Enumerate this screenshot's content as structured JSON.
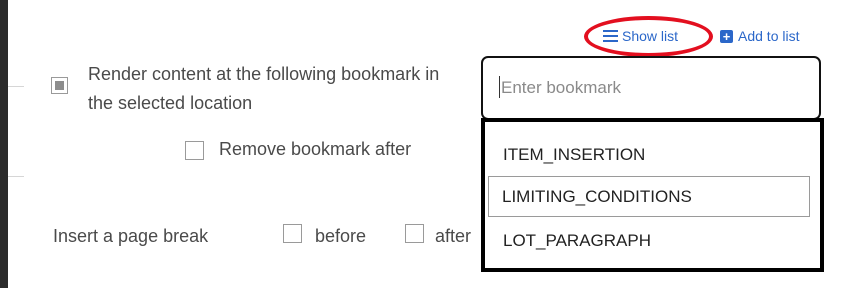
{
  "links": {
    "show_list": "Show list",
    "add_to_list": "Add to list"
  },
  "render_option": {
    "label": "Render content at the following bookmark in the selected location",
    "checked": true
  },
  "bookmark_input": {
    "value": "",
    "placeholder": "Enter bookmark"
  },
  "remove_option": {
    "label": "Remove bookmark after"
  },
  "page_break": {
    "label": "Insert a page break",
    "before_label": "before",
    "after_label": "after"
  },
  "dropdown": {
    "items": [
      {
        "label": "ITEM_INSERTION"
      },
      {
        "label": "LIMITING_CONDITIONS"
      },
      {
        "label": "LOT_PARAGRAPH"
      }
    ],
    "active_index": 1
  },
  "colors": {
    "link": "#2b67c9",
    "highlight": "#e30f1f"
  },
  "icons": {
    "show_list": "list-icon",
    "add_to_list": "plus-square-icon"
  }
}
